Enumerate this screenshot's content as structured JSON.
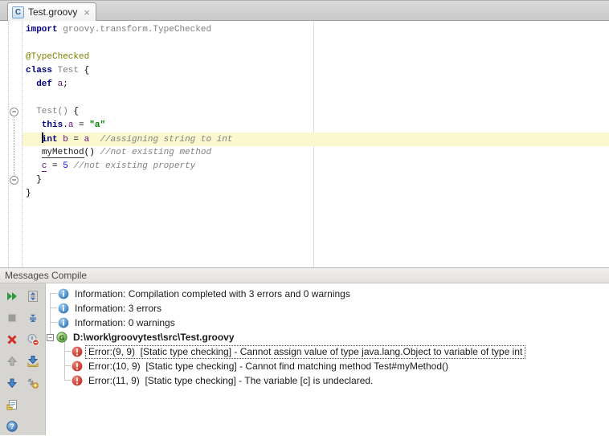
{
  "tab": {
    "title": "Test.groovy",
    "close_label": "×",
    "file_icon_letter": "C"
  },
  "editor": {
    "caret_row_color": "#fbf8d0",
    "lines": [
      {
        "tokens": [
          {
            "t": "import ",
            "c": "kw"
          },
          {
            "t": "groovy.transform.TypeChecked",
            "c": "gray"
          }
        ]
      },
      {
        "tokens": []
      },
      {
        "tokens": [
          {
            "t": "@TypeChecked",
            "c": "ann"
          }
        ]
      },
      {
        "tokens": [
          {
            "t": "class ",
            "c": "kw"
          },
          {
            "t": "Test ",
            "c": "gray"
          },
          {
            "t": "{",
            "c": "pl"
          }
        ]
      },
      {
        "tokens": [
          {
            "t": "  ",
            "c": "pl"
          },
          {
            "t": "def ",
            "c": "kw"
          },
          {
            "t": "a",
            "c": "var"
          },
          {
            "t": ";",
            "c": "pl"
          }
        ]
      },
      {
        "tokens": []
      },
      {
        "fold": "top",
        "tokens": [
          {
            "t": "  ",
            "c": "pl"
          },
          {
            "t": "Test()",
            "c": "gray"
          },
          {
            "t": " {",
            "c": "pl"
          }
        ]
      },
      {
        "tokens": [
          {
            "t": "   ",
            "c": "pl"
          },
          {
            "t": "this",
            "c": "kw"
          },
          {
            "t": ".",
            "c": "pl"
          },
          {
            "t": "a",
            "c": "var"
          },
          {
            "t": " = ",
            "c": "pl"
          },
          {
            "t": "\"a\"",
            "c": "str"
          }
        ]
      },
      {
        "highlight": true,
        "caret": 1,
        "tokens": [
          {
            "t": "   ",
            "c": "pl"
          },
          {
            "t": "int ",
            "c": "kw"
          },
          {
            "t": "b",
            "c": "var"
          },
          {
            "t": " = ",
            "c": "pl"
          },
          {
            "t": "a",
            "c": "var"
          },
          {
            "t": "  ",
            "c": "pl"
          },
          {
            "t": "//assigning string to int",
            "c": "cmt"
          }
        ]
      },
      {
        "tokens": [
          {
            "t": "   ",
            "c": "pl"
          },
          {
            "t": "myMethod",
            "c": "err-ul"
          },
          {
            "t": "() ",
            "c": "pl"
          },
          {
            "t": "//not existing method",
            "c": "cmt"
          }
        ]
      },
      {
        "tokens": [
          {
            "t": "   ",
            "c": "pl"
          },
          {
            "t": "c",
            "c": "var-ul"
          },
          {
            "t": " = ",
            "c": "pl"
          },
          {
            "t": "5",
            "c": "num"
          },
          {
            "t": " ",
            "c": "pl"
          },
          {
            "t": "//not existing property",
            "c": "cmt"
          }
        ]
      },
      {
        "fold": "bottom",
        "tokens": [
          {
            "t": "  ",
            "c": "pl"
          },
          {
            "t": "}",
            "c": "pl"
          }
        ]
      },
      {
        "tokens": [
          {
            "t": "}",
            "c": "pl"
          }
        ]
      }
    ]
  },
  "panel": {
    "title": "Messages Compile",
    "toolbar_icons": [
      "rerun",
      "expand-all",
      "stop",
      "collapse-all",
      "close",
      "hide-info",
      "previous-message",
      "export-to-text-file",
      "next-message",
      "settings",
      "export",
      "help"
    ],
    "tree": [
      {
        "level": 0,
        "icon": "info",
        "text": "Information: Compilation completed with 3 errors and 0 warnings"
      },
      {
        "level": 0,
        "icon": "info",
        "text": "Information: 3 errors"
      },
      {
        "level": 0,
        "icon": "info",
        "text": "Information: 0 warnings"
      },
      {
        "level": 0,
        "icon": "groovy",
        "collapse": true,
        "bold": true,
        "text": "D:\\work\\groovytest\\src\\Test.groovy"
      },
      {
        "level": 1,
        "icon": "error",
        "focused": true,
        "text": "Error:(9, 9)  [Static type checking] - Cannot assign value of type java.lang.Object to variable of type int"
      },
      {
        "level": 1,
        "icon": "error",
        "text": "Error:(10, 9)  [Static type checking] - Cannot find matching method Test#myMethod()"
      },
      {
        "level": 1,
        "icon": "error",
        "text": "Error:(11, 9)  [Static type checking] - The variable [c] is undeclared."
      }
    ]
  },
  "colors": {
    "keyword": "#000080",
    "annotation": "#808000",
    "variable": "#660e7a",
    "string": "#008000",
    "number": "#0000ff",
    "comment": "#808080",
    "unused": "#808080",
    "caret_row": "#fbf8d0",
    "error_icon": "#c4271c",
    "info_icon": "#2d74b5",
    "groovy_icon": "#57a33c"
  }
}
